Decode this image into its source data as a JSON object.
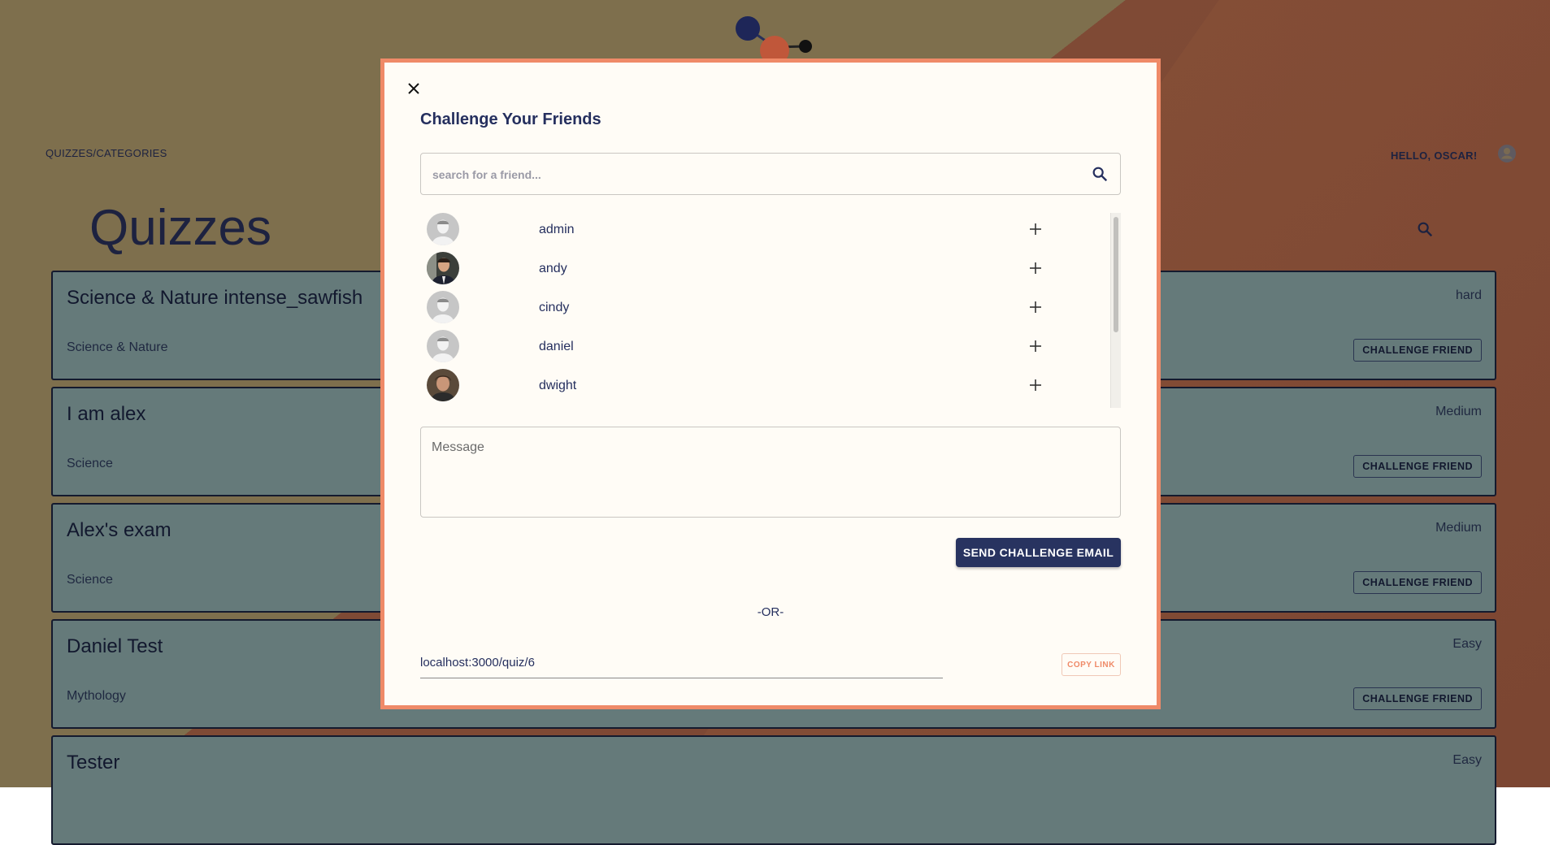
{
  "nav": {
    "left_link": "QUIZZES/CATEGORIES",
    "greeting": "HELLO, OSCAR!"
  },
  "page": {
    "title": "Quizzes"
  },
  "quizzes": [
    {
      "title": "Science & Nature intense_sawfish",
      "category": "Science & Nature",
      "difficulty": "hard",
      "button": "CHALLENGE FRIEND"
    },
    {
      "title": "I am alex",
      "category": "Science",
      "difficulty": "Medium",
      "button": "CHALLENGE FRIEND"
    },
    {
      "title": "Alex's exam",
      "category": "Science",
      "difficulty": "Medium",
      "button": "CHALLENGE FRIEND"
    },
    {
      "title": "Daniel Test",
      "category": "Mythology",
      "difficulty": "Easy",
      "button": "CHALLENGE FRIEND"
    },
    {
      "title": "Tester",
      "category": "",
      "difficulty": "Easy",
      "button": ""
    }
  ],
  "modal": {
    "title": "Challenge Your Friends",
    "search_placeholder": "search for a friend...",
    "friends": [
      {
        "name": "admin",
        "avatar": "default"
      },
      {
        "name": "andy",
        "avatar": "photo"
      },
      {
        "name": "cindy",
        "avatar": "default"
      },
      {
        "name": "daniel",
        "avatar": "default"
      },
      {
        "name": "dwight",
        "avatar": "photo"
      }
    ],
    "message_placeholder": "Message",
    "send_label": "SEND CHALLENGE EMAIL",
    "or_text": "-OR-",
    "link": "localhost:3000/quiz/6",
    "copy_label": "COPY LINK"
  },
  "colors": {
    "accent": "#ef8a68",
    "primary": "#283360",
    "card": "#657a7a"
  }
}
